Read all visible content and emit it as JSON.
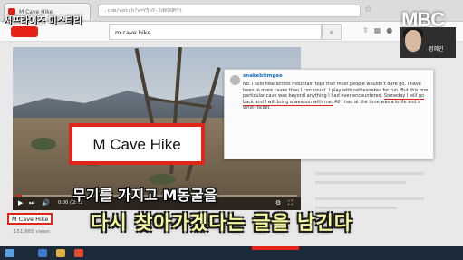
{
  "overlay": {
    "show_title": "서프라이즈 미스터리",
    "channel_logo": "MBC",
    "presenter_name": "정혜인",
    "subtitle_line1": "무기를 가지고 M동굴을",
    "subtitle_line2": "다시 찾아가겠다는 글을 남긴다"
  },
  "browser": {
    "tab_title": "M Cave Hike",
    "address": ".com/watch?v=Y5bY-2dKOQM?t",
    "star_icon": "star-icon"
  },
  "youtube": {
    "search_value": "m cave hike",
    "search_icon": "search-icon"
  },
  "video": {
    "zoom_label": "M Cave Hike",
    "time": "0:00 / 2:49",
    "progress": 0.02,
    "controls": {
      "play": "▶",
      "next": "⏭",
      "volume": "🔊",
      "settings": "⚙",
      "fullscreen": "⛶"
    }
  },
  "comment": {
    "username": "snakebitmgee",
    "text_plain": "No. I solo hike across mountain tops that most people wouldn't dare go. I have been in more caves than I can count. I play with rattlesnakes for fun. But this one particular cave was beyond anything I had ever encountered. ",
    "text_highlight": "Someday I will go back and I will bring a weapon with me.",
    "text_tail": " All I had at the time was a knife and a wrist-rocket."
  },
  "below_video": {
    "title": "M Cave Hike",
    "views": "151,885 views"
  },
  "colors": {
    "highlight_red": "#e1251b",
    "youtube_red": "#e62117",
    "subtitle_yellow": "#f5f79e"
  }
}
